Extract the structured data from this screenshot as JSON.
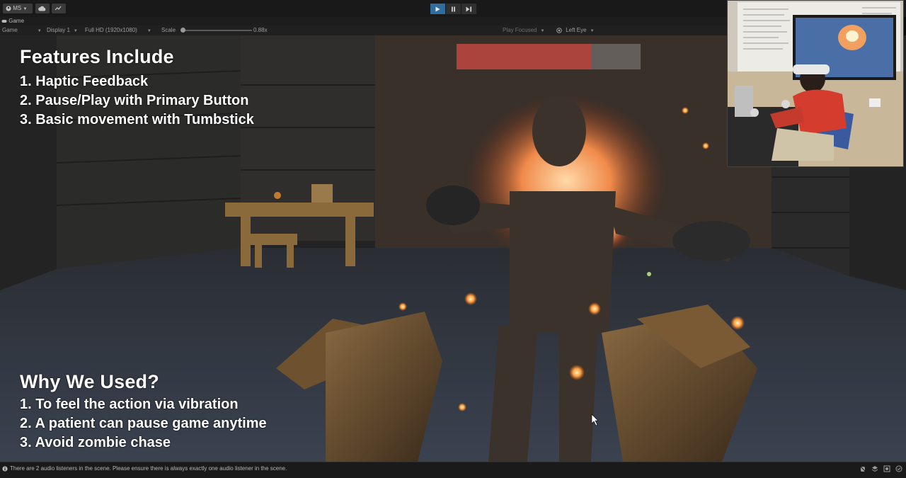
{
  "toolbar": {
    "account_label": "MS",
    "account_icon": "user-icon",
    "cloud_icon": "cloud-icon",
    "collab_icon": "collab-icon",
    "play_icon": "play-icon",
    "pause_icon": "pause-icon",
    "step_icon": "step-icon",
    "play_active_color": "#2e6d9e"
  },
  "tab": {
    "label": "Game"
  },
  "gamebar": {
    "mode": "Game",
    "display": "Display 1",
    "resolution": "Full HD (1920x1080)",
    "scale_label": "Scale",
    "scale_value": "0.88x",
    "play_focused": "Play Focused",
    "eye": "Left Eye"
  },
  "overlay": {
    "features_heading": "Features Include",
    "features": [
      "1. Haptic Feedback",
      "2. Pause/Play with Primary Button",
      "3. Basic movement with Tumbstick"
    ],
    "why_heading": "Why We Used?",
    "reasons": [
      "1. To feel the action via vibration",
      "2. A patient can pause game anytime",
      "3. Avoid zombie chase"
    ]
  },
  "status": {
    "message": "There are 2 audio listeners in the scene. Please ensure there is always exactly one audio listener in the scene."
  }
}
